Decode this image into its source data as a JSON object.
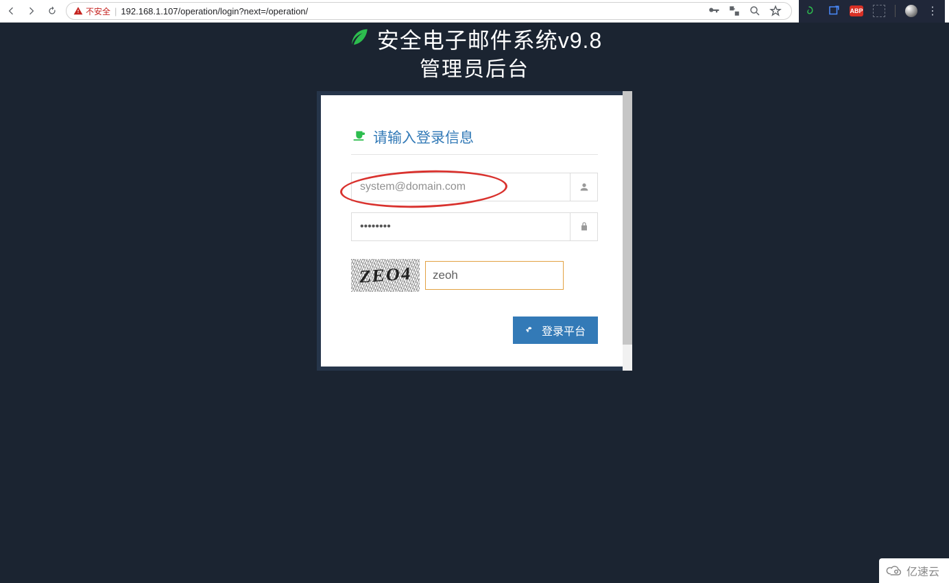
{
  "browser": {
    "insecure_label": "不安全",
    "url": "192.168.1.107/operation/login?next=/operation/"
  },
  "header": {
    "title_line1": "安全电子邮件系统v9.8",
    "title_line2": "管理员后台"
  },
  "form": {
    "heading": "请输入登录信息",
    "username_placeholder": "system@domain.com",
    "username_value": "",
    "password_value": "",
    "captcha_image_text": "ZEO4",
    "captcha_value": "zeoh",
    "login_button_label": "登录平台"
  },
  "extensions": {
    "adblock_label": "ABP"
  },
  "watermark": {
    "text": "亿速云"
  }
}
